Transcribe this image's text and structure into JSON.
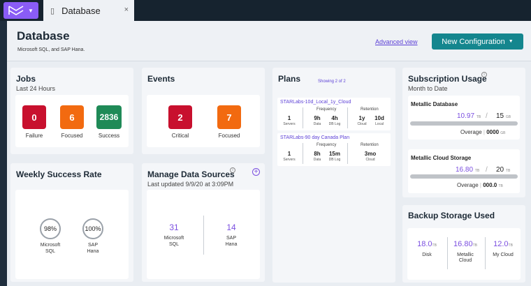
{
  "tab": {
    "title": "Database",
    "close": "×"
  },
  "header": {
    "title": "Database",
    "subtitle": "Microsoft SQL,  and SAP Hana.",
    "advanced_link": "Advanced view",
    "new_config_label": "New Configuration"
  },
  "jobs": {
    "title": "Jobs",
    "subtitle": "Last 24 Hours",
    "stats": [
      {
        "value": "0",
        "label": "Failure",
        "color": "#c8102e"
      },
      {
        "value": "6",
        "label": "Focused",
        "color": "#f26a10"
      },
      {
        "value": "2836",
        "label": "Success",
        "color": "#1f8a57"
      }
    ]
  },
  "events": {
    "title": "Events",
    "stats": [
      {
        "value": "2",
        "label": "Critical",
        "color": "#c8102e"
      },
      {
        "value": "7",
        "label": "Focused",
        "color": "#f26a10"
      }
    ]
  },
  "plans": {
    "title": "Plans",
    "showing": "Showing 2 of 2",
    "items": [
      {
        "name": "STARLabs-10d_Local_1y_Cloud",
        "servers": "1",
        "servers_label": "Servers",
        "frequency_label": "Frequency",
        "freq_data": "9h",
        "freq_data_label": "Data",
        "freq_log": "4h",
        "freq_log_label": "DB Log",
        "retention_label": "Retention",
        "ret_cloud": "1y",
        "ret_cloud_label": "Cloud",
        "ret_local": "10d",
        "ret_local_label": "Local"
      },
      {
        "name": "STARLabs-90 day Canada Plan",
        "servers": "1",
        "servers_label": "Servers",
        "frequency_label": "Frequency",
        "freq_data": "8h",
        "freq_data_label": "Data",
        "freq_log": "15m",
        "freq_log_label": "DB Log",
        "retention_label": "Retention",
        "ret_cloud": "3mo",
        "ret_cloud_label": "Cloud"
      }
    ]
  },
  "subscription": {
    "title": "Subscription Usage",
    "subtitle": "Month to Date",
    "info_icon": "info-icon",
    "items": [
      {
        "name": "Metallic Database",
        "used": "10.97",
        "used_unit": "TB",
        "sep": "/",
        "total": "15",
        "total_unit": "GB",
        "overage_label": "Overage",
        "overage": "0000",
        "overage_unit": "GB"
      },
      {
        "name": "Metallic Cloud Storage",
        "used": "16.80",
        "used_unit": "TB",
        "sep": "/",
        "total": "20",
        "total_unit": "TB",
        "overage_label": "Overage",
        "overage": "000.0",
        "overage_unit": "TB"
      }
    ]
  },
  "weekly": {
    "title": "Weekly Success Rate",
    "items": [
      {
        "value": "98%",
        "label1": "Microsoft",
        "label2": "SQL"
      },
      {
        "value": "100%",
        "label1": "SAP",
        "label2": "Hana"
      }
    ]
  },
  "sources": {
    "title": "Manage Data Sources",
    "updated": "Last updated 9/9/20 at 3:09PM",
    "items": [
      {
        "value": "31",
        "label1": "Microsoft",
        "label2": "SQL"
      },
      {
        "value": "14",
        "label1": "SAP",
        "label2": "Hana"
      }
    ]
  },
  "backup": {
    "title": "Backup Storage Used",
    "items": [
      {
        "value": "18.0",
        "unit": "TB",
        "label1": "Disk",
        "label2": ""
      },
      {
        "value": "16.80",
        "unit": "TB",
        "label1": "Metallic",
        "label2": "Cloud"
      },
      {
        "value": "12.0",
        "unit": "TB",
        "label1": "My Cloud",
        "label2": ""
      }
    ]
  },
  "colors": {
    "accent": "#14868e",
    "purple": "#7b4fe0",
    "link": "#5b3fd6",
    "logo": "#8a5cf6"
  }
}
